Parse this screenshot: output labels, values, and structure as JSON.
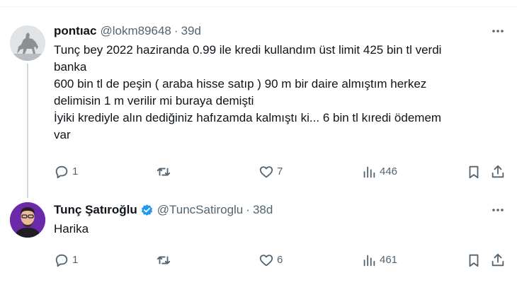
{
  "tweets": [
    {
      "display_name": "pontıac",
      "handle": "@lokm89648",
      "separator": "·",
      "time": "39d",
      "avatar": "horse-rider-statue-icon",
      "body_lines": [
        "Tunç bey 2022 haziranda 0.99 ile kredi kullandım üst limit 425 bin tl verdi",
        "banka",
        "600 bin tl de peşin ( araba hisse satıp )  90 m bir daire almıştım herkez",
        "delimisin 1 m verilir mi buraya demişti",
        "İyiki krediyle alın dediğiniz hafızamda kalmıştı ki... 6 bin tl kıredi ödemem",
        "var"
      ],
      "actions": {
        "reply_count": "1",
        "retweet_count": "",
        "like_count": "7",
        "views_count": "446"
      }
    },
    {
      "display_name": "Tunç Şatıroğlu",
      "verified": true,
      "handle": "@TuncSatiroglu",
      "separator": "·",
      "time": "38d",
      "avatar": "profile-photo",
      "body_lines": [
        "Harika"
      ],
      "actions": {
        "reply_count": "1",
        "retweet_count": "",
        "like_count": "6",
        "views_count": "461"
      }
    }
  ],
  "icons": {
    "more": "more-dots-icon",
    "reply": "reply-icon",
    "retweet": "retweet-icon",
    "like": "heart-icon",
    "views": "views-icon",
    "bookmark": "bookmark-icon",
    "share": "share-icon",
    "verified": "verified-badge-icon"
  },
  "colors": {
    "text_primary": "#0f1419",
    "text_secondary": "#536471",
    "verified_blue": "#1d9bf0",
    "thread_line": "#cfd9de"
  }
}
